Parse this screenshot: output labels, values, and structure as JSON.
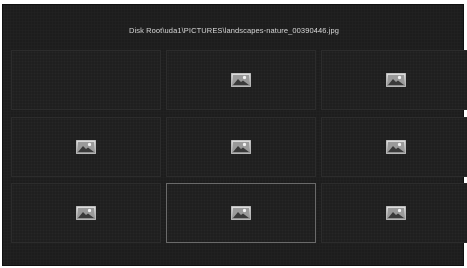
{
  "header": {
    "path": "Disk Root\\uda1\\PICTURES\\landscapes-nature_00390446.jpg"
  },
  "grid": {
    "tiles": [
      {
        "has_thumb": false,
        "icon": "image-icon",
        "selected": false
      },
      {
        "has_thumb": true,
        "icon": "image-icon",
        "selected": false
      },
      {
        "has_thumb": true,
        "icon": "image-icon",
        "selected": false
      },
      {
        "has_thumb": true,
        "icon": "image-icon",
        "selected": false
      },
      {
        "has_thumb": true,
        "icon": "image-icon",
        "selected": false
      },
      {
        "has_thumb": true,
        "icon": "image-icon",
        "selected": false
      },
      {
        "has_thumb": true,
        "icon": "image-icon",
        "selected": false
      },
      {
        "has_thumb": true,
        "icon": "image-icon",
        "selected": true
      },
      {
        "has_thumb": true,
        "icon": "image-icon",
        "selected": false
      }
    ]
  },
  "colors": {
    "background": "#1d1d1d",
    "tile_border": "#2c2c2c",
    "selected_border": "#6a6a6a",
    "text": "#d8d8d8"
  }
}
